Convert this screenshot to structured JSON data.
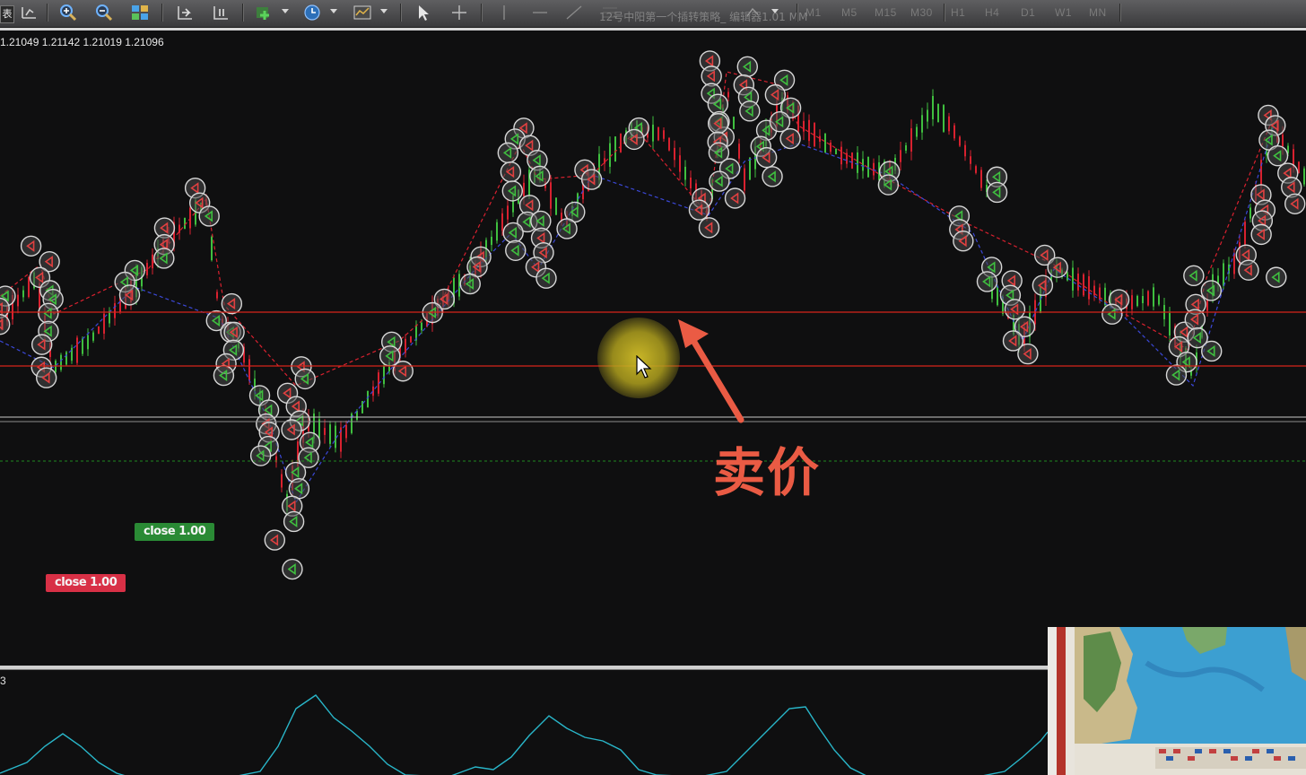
{
  "toolbar": {
    "left_stub": "表",
    "title": "12号中阳第一个插转策略_ 编辑器1.01 MM",
    "timeframes": [
      "M1",
      "M5",
      "M15",
      "M30",
      "H1",
      "H4",
      "D1",
      "W1",
      "MN"
    ],
    "icons": [
      "chart-bars-icon",
      "zoom-in-icon",
      "zoom-out-icon",
      "tile-windows-icon",
      "autoscroll-icon",
      "chart-shift-icon",
      "indicators-icon",
      "periods-icon",
      "templates-icon",
      "cursor-icon",
      "crosshair-icon",
      "vertical-line-icon",
      "horizontal-line-icon",
      "trendline-icon",
      "fibo-icon",
      "text-icon",
      "shapes-icon"
    ]
  },
  "main_chart": {
    "price_readout": "1.21049 1.21142 1.21019 1.21096",
    "close_buttons": [
      {
        "label": "close 1.00",
        "color": "#2a8a35"
      },
      {
        "label": "close 1.00",
        "color": "#d83046"
      }
    ],
    "annotation": "卖价",
    "annotation_color": "#ea5b44",
    "level_line_color": "#e02a1a",
    "bull_color": "#3fbf3f",
    "bear_color": "#d8212f"
  },
  "indicator_panel": {
    "label": "3",
    "line_color": "#29b6c9"
  }
}
